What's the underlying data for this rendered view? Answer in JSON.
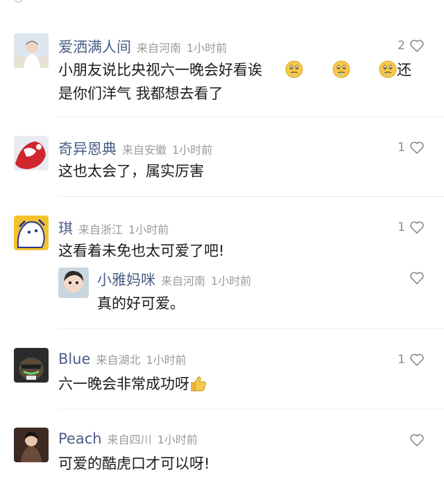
{
  "comments": [
    {
      "username": "爱洒满人间",
      "location": "来自河南",
      "time": "1小时前",
      "likes": "2",
      "text_line1_a": "小朋友说比央视六一晚会好看诶",
      "text_line1_b": "还",
      "text_line2": "是你们洋气  我都想去看了",
      "emojis": [
        "drooling-face",
        "drooling-face",
        "drooling-face"
      ]
    },
    {
      "username": "奇异恩典",
      "location": "来自安徽",
      "time": "1小时前",
      "likes": "1",
      "text": "这也太会了，属实厉害"
    },
    {
      "username": "琪",
      "location": "来自浙江",
      "time": "1小时前",
      "likes": "1",
      "text": "这看着未免也太可爱了吧!",
      "reply": {
        "username": "小雅妈咪",
        "location": "来自河南",
        "time": "1小时前",
        "text": "真的好可爱。"
      }
    },
    {
      "username": "Blue",
      "location": "来自湖北",
      "time": "1小时前",
      "likes": "1",
      "text": "六一晚会非常成功呀",
      "emojis": [
        "thumbs-up"
      ]
    },
    {
      "username": "Peach",
      "location": "来自四川",
      "time": "1小时前",
      "text": "可爱的酷虎口才可以呀!"
    }
  ],
  "colors": {
    "username": "#4a5e87",
    "meta": "#9a9a9a",
    "text": "#1b1b1b",
    "divider": "#ececec",
    "heart": "#8a8a8a"
  }
}
